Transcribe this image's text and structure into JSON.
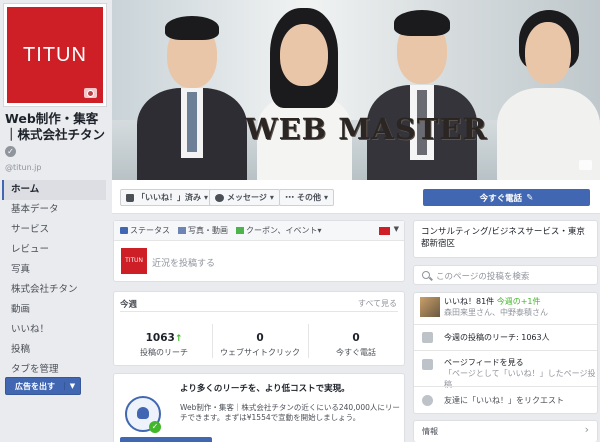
{
  "page": {
    "logo_text": "TITUN",
    "name": "Web制作・集客｜株式会社チタン",
    "verified_glyph": "✓",
    "handle": "@titun.jp"
  },
  "nav": {
    "items": [
      "ホーム",
      "基本データ",
      "サービス",
      "レビュー",
      "写真",
      "株式会社チタン",
      "動画",
      "いいね！",
      "投稿",
      "タブを管理"
    ],
    "active_index": 0
  },
  "ads_button": {
    "label": "広告を出す",
    "caret": "▼"
  },
  "cover": {
    "banner_text": "WEB MASTER"
  },
  "actionbar": {
    "liked_label": "「いいね！」済み",
    "message_label": "メッセージ",
    "more_label": "その他",
    "cta_label": "今すぐ電話",
    "caret": "▾"
  },
  "composer": {
    "tabs": [
      "ステータス",
      "写真・動画",
      "クーポン、イベント"
    ],
    "tab_caret": "▾",
    "avatar_text": "TITUN",
    "placeholder": "近況を投稿する",
    "caret": "▼"
  },
  "week": {
    "title": "今週",
    "see_all": "すべて見る",
    "stats": [
      {
        "value": "1063",
        "trend": "↑",
        "label": "投稿のリーチ"
      },
      {
        "value": "0",
        "trend": "",
        "label": "ウェブサイトクリック"
      },
      {
        "value": "0",
        "trend": "",
        "label": "今すぐ電話"
      }
    ]
  },
  "promo": {
    "title": "より多くのリーチを、より低コストで実現。",
    "body": "Web制作・集客｜株式会社チタンの近くにいる240,000人にリーチできます。まずは¥1554で宣動を開始しましょう。",
    "check_glyph": "✓"
  },
  "right": {
    "about": "コンサルティング/ビジネスサービス・東京都新宿区",
    "search_placeholder": "このページの投稿を検索",
    "likes_line": "いいね！81件",
    "likes_week": "今週の+1件",
    "likes_friends": "森田来里さん、中野泰積さん",
    "reach": "今週の投稿のリーチ: 1063人",
    "feed_title": "ページフィードを見る",
    "feed_sub": "「ページとして「いいね！」したページ投稿",
    "invite": "友達に「いいね！」をリクエスト",
    "info_label": "情報",
    "chevron": "›"
  },
  "colors": {
    "brand_red": "#cd1f25",
    "facebook_blue": "#4267b2",
    "positive_green": "#42b72a"
  }
}
